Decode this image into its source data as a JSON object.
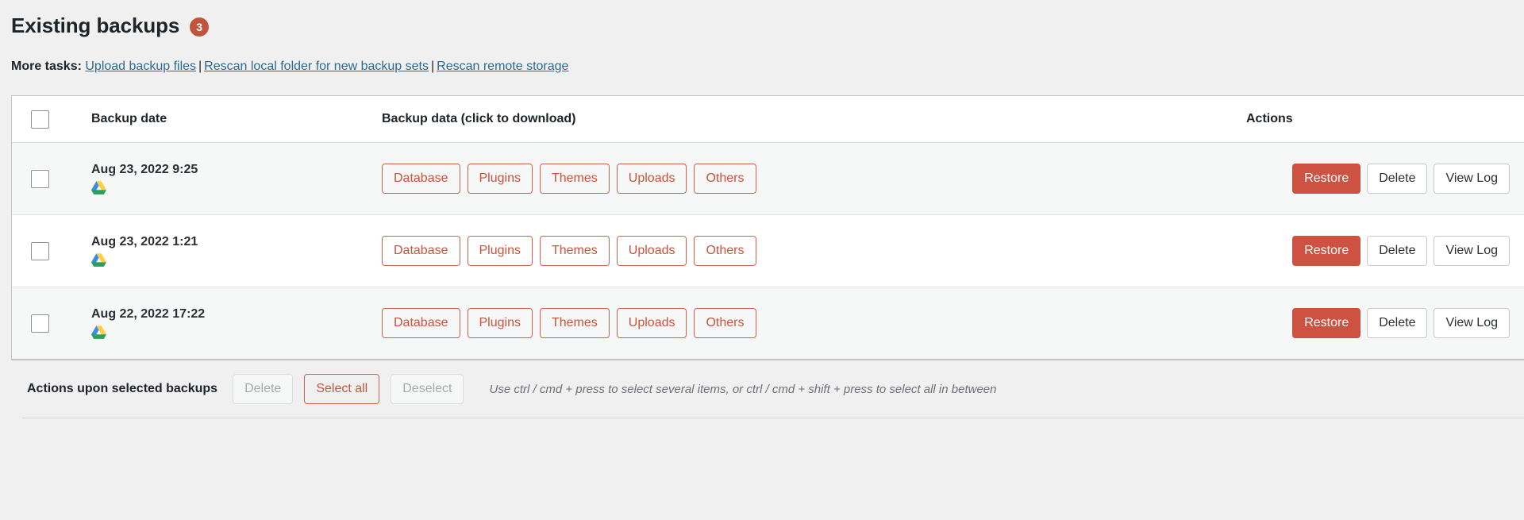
{
  "header": {
    "title": "Existing backups",
    "count_badge": "3",
    "badge_color": "#c0553b"
  },
  "more_tasks": {
    "label": "More tasks:",
    "separator": "|",
    "links": [
      "Upload backup files",
      "Rescan local folder for new backup sets",
      "Rescan remote storage"
    ],
    "link_color": "#2c6a93"
  },
  "table": {
    "columns": {
      "checkbox": "",
      "date": "Backup date",
      "data": "Backup data (click to download)",
      "actions": "Actions"
    },
    "rows": [
      {
        "date": "Aug 23, 2022 9:25",
        "storage_icon": "google-drive-icon",
        "data_buttons": [
          "Database",
          "Plugins",
          "Themes",
          "Uploads",
          "Others"
        ],
        "action_buttons": [
          "Restore",
          "Delete",
          "View Log"
        ]
      },
      {
        "date": "Aug 23, 2022 1:21",
        "storage_icon": "google-drive-icon",
        "data_buttons": [
          "Database",
          "Plugins",
          "Themes",
          "Uploads",
          "Others"
        ],
        "action_buttons": [
          "Restore",
          "Delete",
          "View Log"
        ]
      },
      {
        "date": "Aug 22, 2022 17:22",
        "storage_icon": "google-drive-icon",
        "data_buttons": [
          "Database",
          "Plugins",
          "Themes",
          "Uploads",
          "Others"
        ],
        "action_buttons": [
          "Restore",
          "Delete",
          "View Log"
        ]
      }
    ]
  },
  "bottom_bar": {
    "label": "Actions upon selected backups",
    "delete_label": "Delete",
    "select_all_label": "Select all",
    "deselect_label": "Deselect",
    "hint": "Use ctrl / cmd + press to select several items, or ctrl / cmd + shift + press to select all in between"
  },
  "colors": {
    "accent_red": "#ce5242",
    "outline_red": "#d0614c",
    "text": "#1d2327",
    "page_bg": "#f0f0f1"
  }
}
